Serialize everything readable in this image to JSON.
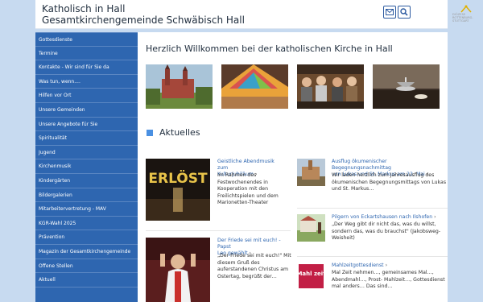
{
  "header": {
    "title_line1": "Katholisch in Hall",
    "title_line2": "Gesamtkirchengemeinde Schwäbisch Hall",
    "mail_icon": "mail-icon",
    "search_icon": "search-icon",
    "logo_line1": "DIÖZESE",
    "logo_line2": "ROTTENBURG-STUTTGART"
  },
  "sidebar": {
    "items": [
      {
        "label": "Gottesdienste"
      },
      {
        "label": "Termine"
      },
      {
        "label": "Kontakte - Wir sind für Sie da"
      },
      {
        "label": "Was tun, wenn...."
      },
      {
        "label": "Hilfen vor Ort"
      },
      {
        "label": "Unsere Gemeinden"
      },
      {
        "label": "Unsere Angebote für Sie"
      },
      {
        "label": "Spiritualität"
      },
      {
        "label": "Jugend"
      },
      {
        "label": "Kirchenmusik"
      },
      {
        "label": "Kindergärten"
      },
      {
        "label": "Bildergalerien"
      },
      {
        "label": "Mitarbeitervertretung - MAV"
      },
      {
        "label": "KGR-Wahl 2025"
      },
      {
        "label": "Prävention"
      },
      {
        "label": "Magazin der Gesamtkirchengemeinde"
      },
      {
        "label": "Offene Stellen"
      },
      {
        "label": "Aktuell"
      }
    ]
  },
  "main": {
    "welcome": "Herzlich Willkommen bei der katholischen Kirche in Hall",
    "section_title": "Aktuelles",
    "news": [
      {
        "title1": "Geistliche Abendmusik zum",
        "title2": "Kulturjubiläum",
        "text": [
          "Im Rahmen des",
          "Festwochenendes in",
          "Kooperation mit den",
          "Freilichtspielen und dem",
          "Marionetten-Theater"
        ],
        "img_text": "ERLÖST"
      },
      {
        "title1": "Der Friede sei mit euch! - Papst",
        "title2": "Leo gewählt",
        "text": [
          "„Der Friede sei mit euch!\" Mit",
          "diesem Gruß des",
          "auferstandenen Christus am",
          "Ostertag, begrüßt der…"
        ]
      },
      {
        "title1": "Ausflug ökumenischer Begegnungsnachmittag",
        "title2": "von Lukas und St. Markus am 22. Mai",
        "text": [
          "Wir laden herzlich zum Jahresausflug des",
          "ökumenischen Begegnungsmittags von Lukas",
          "und St. Markus…"
        ]
      },
      {
        "title1": "Pilgern von Eckartshausen nach Ilshofen",
        "title2": "",
        "text": [
          "„Der Weg gibt dir nicht das, was du willst,",
          "sondern das, was du brauchst\" (Jakobsweg-",
          "Weisheit)"
        ]
      },
      {
        "title1": "Mahlzeitgottesdienst",
        "title2": "",
        "text": [
          "Mal Zeit nehmen…, gemeinsames Mal…,",
          "Abendmahl…, Prost- Mahlzeit…, Gottesdienst",
          "mal anders… Das sind…"
        ],
        "img_text": "Mahl zeit"
      }
    ],
    "chevron": "›"
  },
  "colors": {
    "background": "#c7daf0",
    "sidebar": "#2e66b0",
    "link": "#2e66b0",
    "accent_square": "#4a90e2"
  }
}
